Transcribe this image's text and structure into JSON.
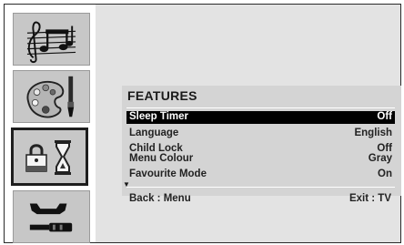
{
  "sidebar": {
    "tabs": [
      {
        "name": "sound",
        "icon": "music-notes-icon",
        "active": false
      },
      {
        "name": "picture",
        "icon": "paint-palette-icon",
        "active": false
      },
      {
        "name": "features",
        "icon": "lock-hourglass-icon",
        "active": true
      },
      {
        "name": "install",
        "icon": "wrench-screwdriver-icon",
        "active": false
      }
    ]
  },
  "menu": {
    "title": "FEATURES",
    "items": [
      {
        "label": "Sleep Timer",
        "value": "Off",
        "selected": true
      },
      {
        "label": "Language",
        "value": "English",
        "selected": false
      },
      {
        "label": "Child Lock",
        "value": "Off",
        "selected": false
      },
      {
        "label": "Menu Colour",
        "value": "Gray",
        "selected": false
      },
      {
        "label": "Favourite Mode",
        "value": "On",
        "selected": false
      }
    ],
    "scroll_indicator": "▼"
  },
  "footer": {
    "back_label": "Back : Menu",
    "exit_label": "Exit : TV"
  },
  "colors": {
    "screen_background": "#e3e3e3",
    "panel_background": "#d4d4d4",
    "selected_row": "#000000",
    "tab_background": "#c7c7c7"
  }
}
